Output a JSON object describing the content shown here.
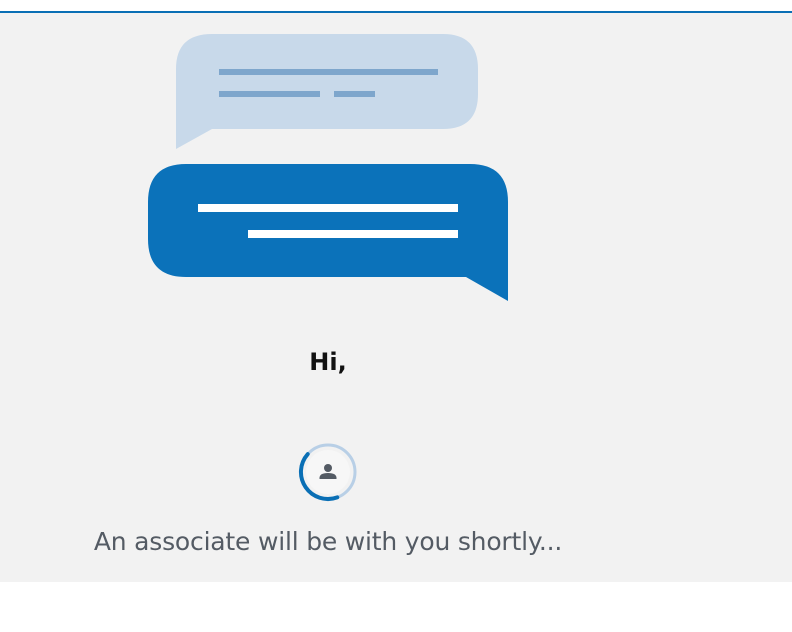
{
  "greeting": {
    "text": "Hi,"
  },
  "status": {
    "message": "An associate will be with you shortly..."
  },
  "icons": {
    "illustration": "chat-bubbles-icon",
    "agent": "person-icon",
    "loading": "loading-spinner-icon"
  },
  "colors": {
    "accent": "#0a6fb5",
    "bubble_light": "#c8d9ea",
    "bubble_light_lines": "#7ea6cc",
    "bubble_dark": "#0b72ba",
    "panel_background": "#f2f2f2",
    "message_text": "#545b64"
  }
}
